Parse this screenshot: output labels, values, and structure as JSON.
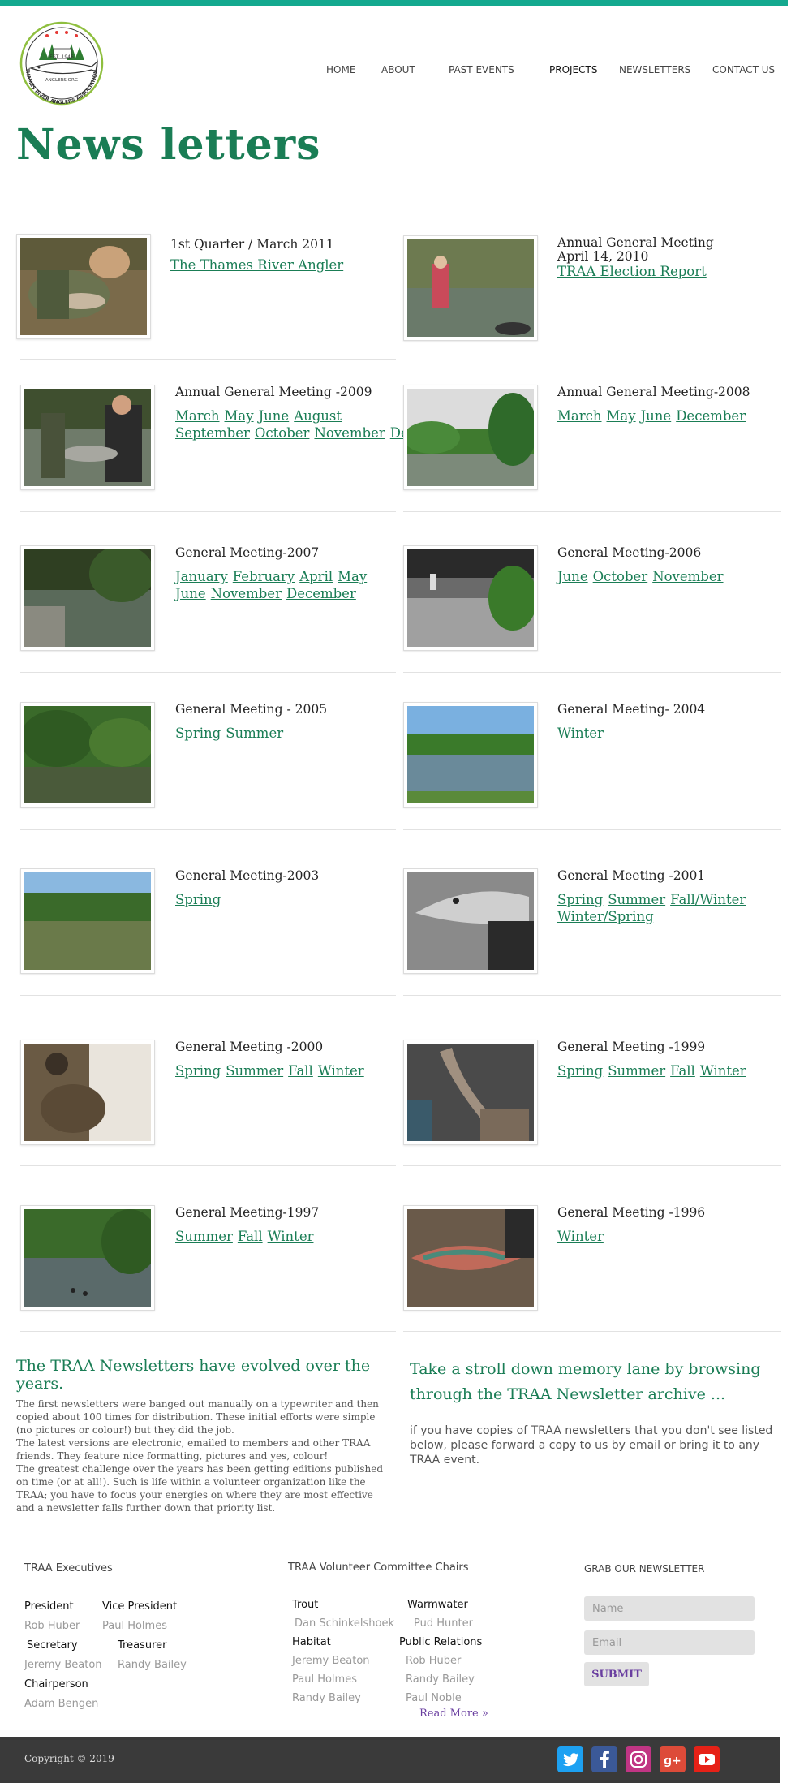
{
  "logo": {
    "est": "EST. 1946",
    "url_text": "ANGLERS.ORG",
    "ring_text": "THAMES RIVER ANGLERS ASSOCIATION"
  },
  "nav": {
    "items": [
      "HOME",
      "ABOUT",
      "PAST EVENTS",
      "PROJECTS",
      "NEWSLETTERS",
      "CONTACT US"
    ]
  },
  "page_title": "News letters",
  "cards": [
    {
      "title": "1st Quarter / March 2011",
      "links": [
        "The Thames River Angler"
      ]
    },
    {
      "title": "Annual General Meeting",
      "title2": "April 14, 2010",
      "links": [
        "TRAA Election Report "
      ]
    },
    {
      "title": "Annual General Meeting -2009",
      "links": [
        "March",
        "May",
        "June",
        "August",
        "September",
        "October",
        "November",
        "December"
      ]
    },
    {
      "title": "Annual General Meeting-2008",
      "links": [
        "March",
        "May",
        "June",
        "December"
      ]
    },
    {
      "title": "General Meeting-2007",
      "links": [
        "January",
        "February",
        "April",
        "May",
        "June",
        "November",
        "December"
      ]
    },
    {
      "title": "General Meeting-2006",
      "links": [
        "June",
        "October",
        "November"
      ]
    },
    {
      "title": "General Meeting - 2005",
      "links": [
        "Spring",
        "Summer"
      ]
    },
    {
      "title": "General Meeting- 2004",
      "links": [
        "Winter"
      ]
    },
    {
      "title": "General Meeting-2003",
      "links": [
        "Spring"
      ]
    },
    {
      "title": "General Meeting -2001",
      "links": [
        "Spring",
        "Summer",
        "Fall/Winter",
        "Winter/Spring"
      ]
    },
    {
      "title": "General Meeting -2000",
      "links": [
        "Spring",
        "Summer",
        "Fall",
        "Winter"
      ]
    },
    {
      "title": "General Meeting -1999",
      "links": [
        "Spring",
        "Summer",
        "Fall",
        "Winter"
      ]
    },
    {
      "title": "General Meeting-1997",
      "links": [
        "Summer",
        "Fall",
        "Winter"
      ]
    },
    {
      "title": "General Meeting -1996",
      "links": [
        "Winter"
      ]
    }
  ],
  "evolved": {
    "title": "The TRAA Newsletters have evolved over the years.",
    "lines": [
      "The first newsletters were banged out manually on a typewriter and then",
      "copied about 100 times for distribution. These initial efforts were simple",
      "(no pictures or colour!) but they did the job.",
      "The latest versions are electronic, emailed to members and other TRAA",
      "friends. They feature nice formatting, pictures and yes, colour!",
      "The greatest challenge over the years has been getting editions published",
      "on time (or at all!). Such is life within a volunteer organization like the",
      "TRAA; you have to focus your energies on where they are most effective",
      "and a newsletter falls further down that priority list."
    ]
  },
  "stroll": {
    "title": "Take a stroll down memory lane by browsing through the TRAA Newsletter archive ...",
    "text": "if you have copies of TRAA newsletters that you don't see listed below, please forward a copy to us by email or bring it to any TRAA event."
  },
  "footer": {
    "executives_heading": "TRAA Executives",
    "executives": {
      "president_label": "President",
      "president_name": "Rob Huber",
      "vp_label": "Vice President",
      "vp_name": "Paul Holmes",
      "secretary_label": "Secretary",
      "secretary_name": "Jeremy Beaton",
      "treasurer_label": "Treasurer",
      "treasurer_name": "Randy Bailey",
      "chair_label": "Chairperson",
      "chair_name": "Adam Bengen"
    },
    "committee_heading": "TRAA Volunteer Committee Chairs",
    "committee": {
      "trout_label": "Trout",
      "trout_name": "Dan Schinkelshoek",
      "warm_label": "Warmwater",
      "warm_name": "Pud Hunter",
      "habitat_label": "Habitat",
      "habitat_names": [
        "Jeremy Beaton",
        "Paul Holmes",
        "Randy Bailey"
      ],
      "pr_label": "Public Relations",
      "pr_names": [
        "Rob Huber",
        "Randy Bailey",
        "Paul Noble"
      ]
    },
    "read_more": "Read More »",
    "newsletter_heading": "GRAB OUR NEWSLETTER",
    "name_placeholder": "Name",
    "email_placeholder": "Email",
    "submit_label": "SUBMIT",
    "copyright": "Copyright © 2019",
    "social": [
      "twitter-icon",
      "facebook-icon",
      "instagram-icon",
      "google-plus-icon",
      "youtube-icon"
    ],
    "social_colors": [
      "#1da1f2",
      "#3b5998",
      "#c13584",
      "#dd4b39",
      "#e62117"
    ]
  }
}
